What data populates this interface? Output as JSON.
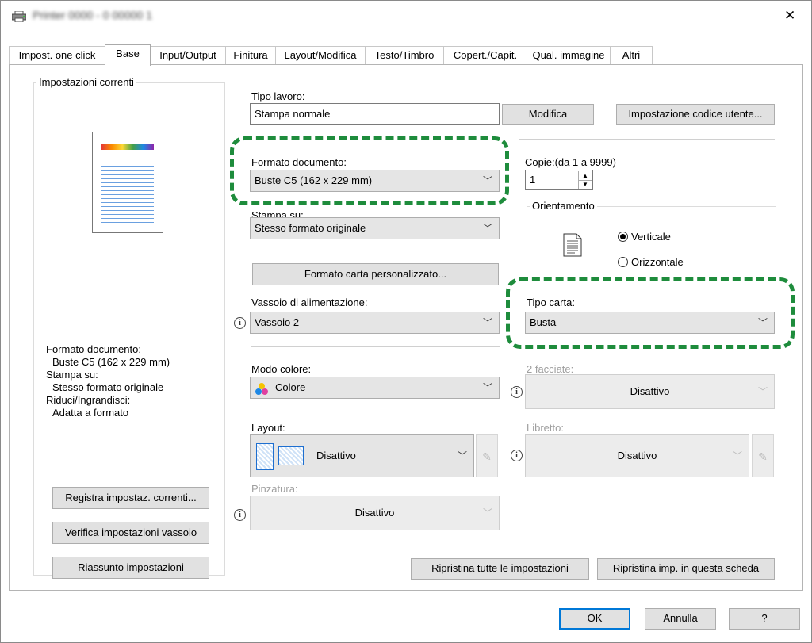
{
  "window": {
    "title_blurred": "Printer 0000 - 0 00000 1",
    "close_glyph": "✕"
  },
  "tabs": [
    {
      "label": "Impost. one click"
    },
    {
      "label": "Base"
    },
    {
      "label": "Input/Output"
    },
    {
      "label": "Finitura"
    },
    {
      "label": "Layout/Modifica"
    },
    {
      "label": "Testo/Timbro"
    },
    {
      "label": "Copert./Capit."
    },
    {
      "label": "Qual. immagine"
    },
    {
      "label": "Altri"
    }
  ],
  "current_settings": {
    "group_title": "Impostazioni correnti",
    "summary": [
      {
        "text": "Formato documento:",
        "indent": false
      },
      {
        "text": "Buste C5 (162 x 229 mm)",
        "indent": true
      },
      {
        "text": "Stampa su:",
        "indent": false
      },
      {
        "text": "Stesso formato originale",
        "indent": true
      },
      {
        "text": "Riduci/Ingrandisci:",
        "indent": false
      },
      {
        "text": "Adatta a formato",
        "indent": true
      }
    ],
    "buttons": {
      "save": "Registra impostaz. correnti...",
      "tray": "Verifica impostazioni vassoio",
      "summary": "Riassunto impostazioni"
    }
  },
  "job": {
    "label": "Tipo lavoro:",
    "value": "Stampa normale",
    "modify_button": "Modifica",
    "user_code_button": "Impostazione codice utente..."
  },
  "document_size": {
    "label": "Formato documento:",
    "value": "Buste C5 (162 x 229 mm)"
  },
  "print_on": {
    "label_partial": "Stampa su:",
    "value": "Stesso formato originale"
  },
  "custom_paper_button": "Formato carta personalizzato...",
  "copies": {
    "label": "Copie:(da 1 a 9999)",
    "value": "1"
  },
  "orientation": {
    "title": "Orientamento",
    "portrait": "Verticale",
    "landscape": "Orizzontale",
    "selected": "Verticale"
  },
  "input_tray": {
    "label": "Vassoio di alimentazione:",
    "value": "Vassoio 2"
  },
  "paper_type": {
    "label": "Tipo carta:",
    "value": "Busta"
  },
  "color_mode": {
    "label": "Modo colore:",
    "value": "Colore"
  },
  "duplex": {
    "label": "2 facciate:",
    "value": "Disattivo"
  },
  "layout": {
    "label": "Layout:",
    "value": "Disattivo"
  },
  "booklet": {
    "label": "Libretto:",
    "value": "Disattivo"
  },
  "staple": {
    "label": "Pinzatura:",
    "value": "Disattivo"
  },
  "reset_all_button": "Ripristina tutte le impostazioni",
  "reset_tab_button": "Ripristina imp. in questa scheda",
  "footer": {
    "ok": "OK",
    "cancel": "Annulla",
    "help": "?"
  },
  "colors": {
    "highlight": "#1e8c3c",
    "ok_border": "#0078d7"
  }
}
